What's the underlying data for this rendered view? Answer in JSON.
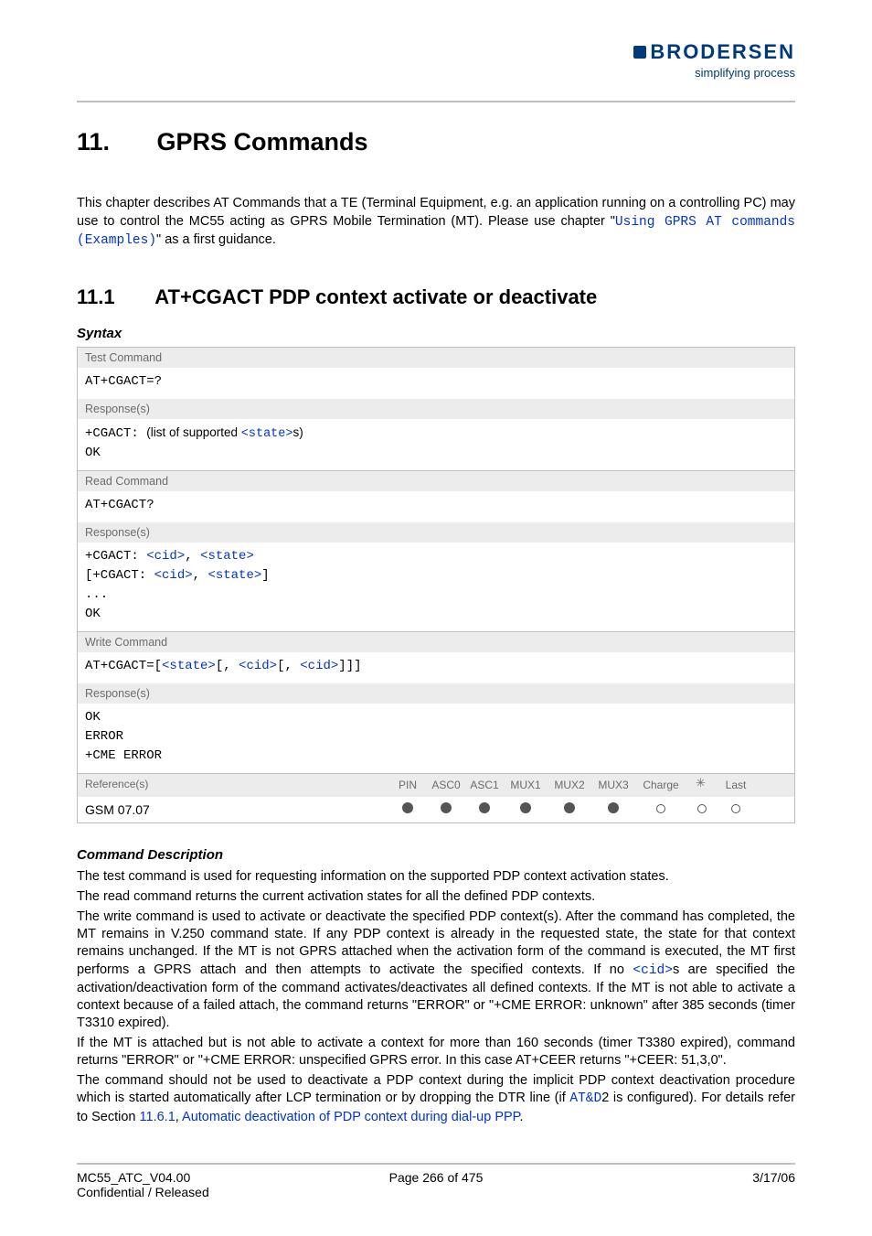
{
  "brand": {
    "name": "BRODERSEN",
    "tagline": "simplifying process"
  },
  "chapter": {
    "number": "11.",
    "title": "GPRS Commands"
  },
  "intro": {
    "part1": "This chapter describes AT Commands that a TE (Terminal Equipment, e.g. an application running on a controlling PC) may use to control the MC55 acting as GPRS Mobile Termination (MT). Please use chapter \"",
    "link": "Using GPRS AT commands (Examples)",
    "part2": "\" as a first guidance."
  },
  "section": {
    "number": "11.1",
    "title": "AT+CGACT   PDP context activate or deactivate"
  },
  "syntax": {
    "heading": "Syntax",
    "test": {
      "label": "Test Command",
      "cmd": "AT+CGACT=?",
      "resp_label": "Response(s)",
      "resp_prefix": "+CGACT: ",
      "resp_mid": "(list of supported ",
      "resp_param": "<state>",
      "resp_suffix": "s)",
      "ok": "OK"
    },
    "read": {
      "label": "Read Command",
      "cmd": "AT+CGACT?",
      "resp_label": "Response(s)",
      "line1_pre": "+CGACT: ",
      "cid": "<cid>",
      "comma": ", ",
      "state": "<state>",
      "line2_pre": "[+CGACT: ",
      "line2_suf": "]",
      "dots": "...",
      "ok": "OK"
    },
    "write": {
      "label": "Write Command",
      "cmd_pre": "AT+CGACT=[",
      "state": "<state>",
      "m1": "[, ",
      "cid": "<cid>",
      "m2": "[, ",
      "cid2": "<cid>",
      "suf": "]]]",
      "resp_label": "Response(s)",
      "ok": "OK",
      "err": "ERROR",
      "cme": "+CME ERROR"
    },
    "ref": {
      "label": "Reference(s)",
      "cols": [
        "PIN",
        "ASC0",
        "ASC1",
        "MUX1",
        "MUX2",
        "MUX3",
        "Charge",
        "",
        "Last"
      ],
      "value": "GSM 07.07",
      "dots": [
        "f",
        "f",
        "f",
        "f",
        "f",
        "f",
        "o",
        "o",
        "o"
      ]
    }
  },
  "desc": {
    "heading": "Command Description",
    "p1": "The test command is used for requesting information on the supported PDP context activation states.",
    "p2": "The read command returns the current activation states for all the defined PDP contexts.",
    "p3a": "The write command is used to activate or deactivate the specified PDP context(s). After the command has completed, the MT remains in V.250 command state. If any PDP context is already in the requested state, the state for that context remains unchanged. If the MT is not GPRS attached when the activation form of the command is executed, the MT first performs a GPRS attach and then attempts to activate the specified contexts. If no ",
    "p3_param": "<cid>",
    "p3b": "s are specified the activation/deactivation form of the command activates/deactivates all defined contexts. If the MT is not able to activate a context because of a failed attach, the command returns \"ERROR\" or \"+CME ERROR: unknown\" after 385 seconds (timer T3310 expired).",
    "p4": "If the MT is attached but is not able to activate a context for more than 160 seconds (timer T3380 expired), command returns \"ERROR\" or \"+CME ERROR: unspecified GPRS error. In this case AT+CEER returns \"+CEER: 51,3,0\".",
    "p5a": "The command should not be used to deactivate a PDP context during the implicit PDP context deactivation procedure which is started automatically after LCP termination or by dropping the DTR line (if ",
    "p5_cmd": "AT&D",
    "p5b": "2 is configured). For details refer to Section ",
    "p5_link1": "11.6.1",
    "p5c": ", ",
    "p5_link2": "Automatic deactivation of PDP context during dial-up PPP",
    "p5d": "."
  },
  "footer": {
    "left1": "MC55_ATC_V04.00",
    "left2": "Confidential / Released",
    "center": "Page 266 of 475",
    "right": "3/17/06"
  }
}
